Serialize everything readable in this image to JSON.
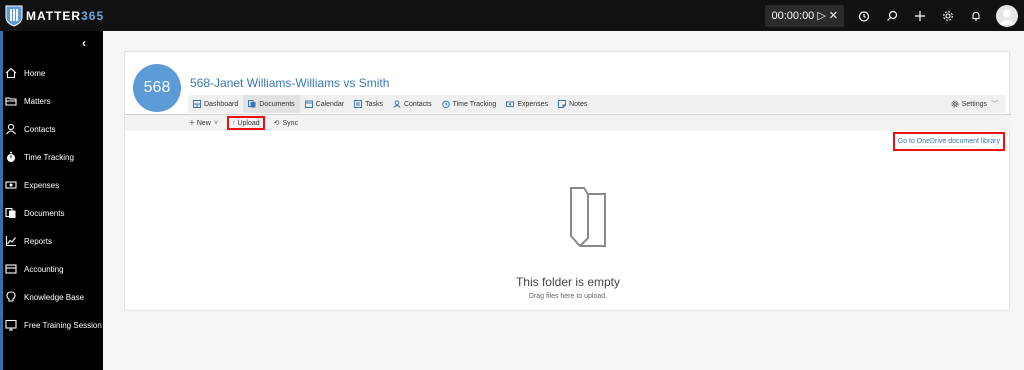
{
  "app": {
    "brand_prefix": "MATTER",
    "brand_number": "365"
  },
  "topbar": {
    "timer": "00:00:00"
  },
  "sidebar": {
    "items": [
      {
        "label": "Home",
        "icon": "home-icon"
      },
      {
        "label": "Matters",
        "icon": "folder-icon"
      },
      {
        "label": "Contacts",
        "icon": "person-icon"
      },
      {
        "label": "Time Tracking",
        "icon": "stopwatch-icon"
      },
      {
        "label": "Expenses",
        "icon": "money-icon"
      },
      {
        "label": "Documents",
        "icon": "documents-icon"
      },
      {
        "label": "Reports",
        "icon": "chart-icon"
      },
      {
        "label": "Accounting",
        "icon": "ledger-icon"
      },
      {
        "label": "Knowledge Base",
        "icon": "lightbulb-icon"
      },
      {
        "label": "Free Training Session",
        "icon": "training-icon"
      }
    ]
  },
  "matter": {
    "number": "568",
    "title": "568-Janet Williams-Williams vs Smith"
  },
  "tabs": [
    {
      "label": "Dashboard",
      "icon": "dashboard-icon"
    },
    {
      "label": "Documents",
      "icon": "documents-icon",
      "active": true
    },
    {
      "label": "Calendar",
      "icon": "calendar-icon"
    },
    {
      "label": "Tasks",
      "icon": "tasks-icon"
    },
    {
      "label": "Contacts",
      "icon": "person-icon"
    },
    {
      "label": "Time Tracking",
      "icon": "clock-icon"
    },
    {
      "label": "Expenses",
      "icon": "money-icon"
    },
    {
      "label": "Notes",
      "icon": "notes-icon"
    }
  ],
  "settings_label": "Settings",
  "doc_toolbar": {
    "new_label": "New",
    "upload_label": "Upload",
    "sync_label": "Sync"
  },
  "onedrive_link": "Go to OneDrive document library",
  "empty": {
    "title": "This folder is empty",
    "subtitle": "Drag files here to upload."
  },
  "colors": {
    "accent": "#3a78b5",
    "badge": "#5b9bd8",
    "highlight": "#ee1111"
  }
}
